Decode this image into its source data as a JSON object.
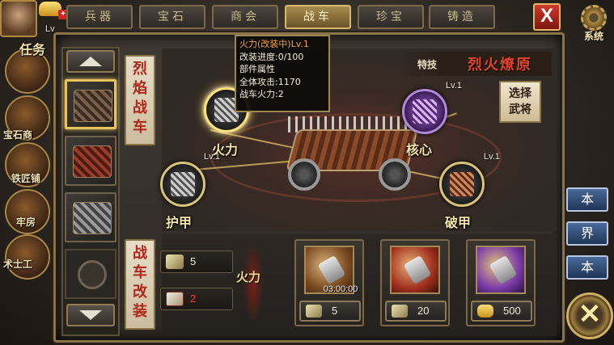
{
  "top_tabs": [
    {
      "label": "兵器",
      "active": false
    },
    {
      "label": "宝石",
      "active": false
    },
    {
      "label": "商会",
      "active": false
    },
    {
      "label": "战车",
      "active": true
    },
    {
      "label": "珍宝",
      "active": false
    },
    {
      "label": "铸造",
      "active": false
    }
  ],
  "close_glyph": "X",
  "system": {
    "label": "系统",
    "icon": "gear-icon"
  },
  "player": {
    "level_prefix": "Lv"
  },
  "left_hud": [
    {
      "label": "任务"
    },
    {
      "label": "宝石商"
    },
    {
      "label": "铁匠铺"
    },
    {
      "label": "牢房"
    },
    {
      "label": "术士工"
    }
  ],
  "chariot_name": [
    "烈",
    "焰",
    "战",
    "车"
  ],
  "modify_title": [
    "战",
    "车",
    "改",
    "装"
  ],
  "skill": {
    "tag": "特技",
    "name": "烈火燎原"
  },
  "general_button": {
    "line1": "选择",
    "line2": "武将"
  },
  "tooltip": {
    "title": "火力(改装中)",
    "title_level": "Lv.1",
    "progress": "改装进度:0/100",
    "attr_header": "部件属性",
    "attack": "全体攻击:1170",
    "firepower": "战车火力:2"
  },
  "parts": {
    "firepower": {
      "label": "火力",
      "level": "Lv.1"
    },
    "core": {
      "label": "核心",
      "level": "Lv.1"
    },
    "armor": {
      "label": "护甲",
      "level": "Lv.1"
    },
    "pierce": {
      "label": "破甲",
      "level": "Lv.1"
    }
  },
  "resources": {
    "hammers": "5",
    "cards": "2"
  },
  "modify_label": "火力",
  "upgrade_costs": [
    {
      "timer": "03:00:00",
      "cost": "5",
      "currency": "hammer-icon",
      "img": "bronze-hammer"
    },
    {
      "timer": "",
      "cost": "20",
      "currency": "hammer-icon",
      "img": "red-hammer"
    },
    {
      "timer": "",
      "cost": "500",
      "currency": "gold-ingot-icon",
      "img": "purple-hammer"
    }
  ],
  "right_hud": [
    "本",
    "界",
    "本"
  ],
  "colors": {
    "accent_gold": "#d8b868",
    "skill_red": "#e8432a",
    "warning_red": "#ff3b2a"
  }
}
